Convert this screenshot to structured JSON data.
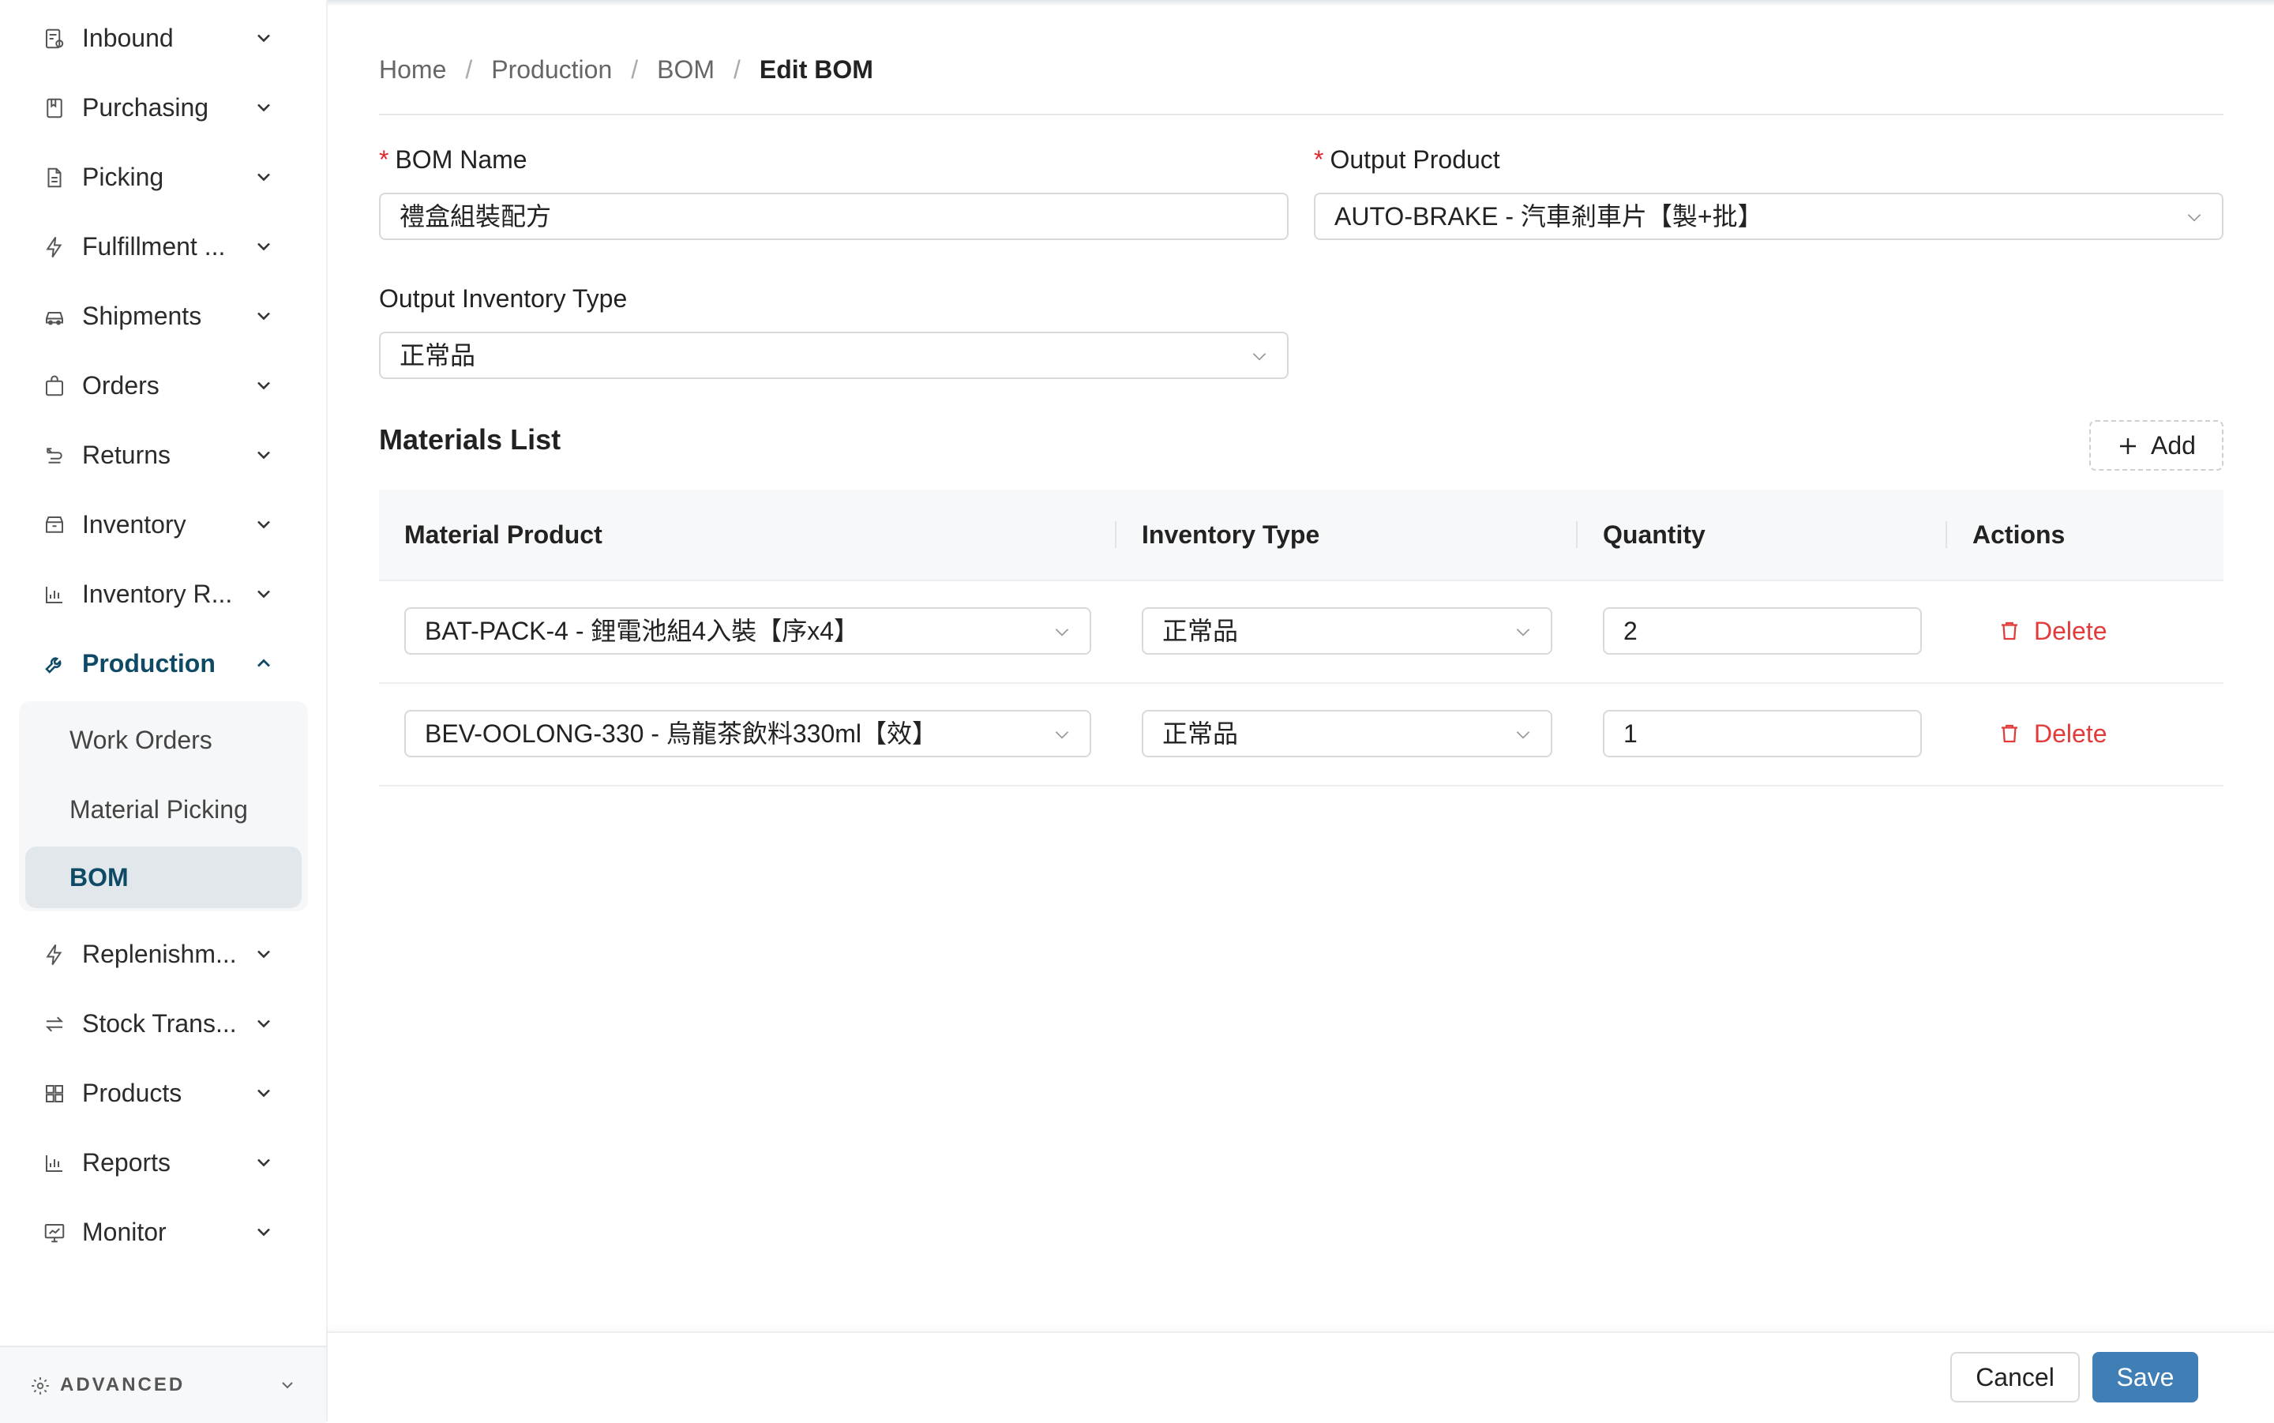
{
  "sidebar": {
    "items": [
      {
        "label": "Inbound",
        "icon": "inbound-icon"
      },
      {
        "label": "Purchasing",
        "icon": "purchasing-icon"
      },
      {
        "label": "Picking",
        "icon": "picking-icon"
      },
      {
        "label": "Fulfillment ...",
        "icon": "fulfillment-icon"
      },
      {
        "label": "Shipments",
        "icon": "shipments-icon"
      },
      {
        "label": "Orders",
        "icon": "orders-icon"
      },
      {
        "label": "Returns",
        "icon": "returns-icon"
      },
      {
        "label": "Inventory",
        "icon": "inventory-icon"
      },
      {
        "label": "Inventory R...",
        "icon": "inventory-report-icon"
      },
      {
        "label": "Production",
        "icon": "production-icon"
      },
      {
        "label": "Replenishm...",
        "icon": "replenishment-icon"
      },
      {
        "label": "Stock Trans...",
        "icon": "stock-transfer-icon"
      },
      {
        "label": "Products",
        "icon": "products-icon"
      },
      {
        "label": "Reports",
        "icon": "reports-icon"
      },
      {
        "label": "Monitor",
        "icon": "monitor-icon"
      }
    ],
    "active_item": "Production",
    "submenu": [
      {
        "label": "Work Orders"
      },
      {
        "label": "Material Picking"
      },
      {
        "label": "BOM"
      }
    ],
    "selected_submenu": "BOM",
    "advanced_label": "ADVANCED"
  },
  "breadcrumb": {
    "items": [
      "Home",
      "Production",
      "BOM"
    ],
    "current": "Edit BOM",
    "separator": "/"
  },
  "form": {
    "bom_name_label": "BOM Name",
    "bom_name_value": "禮盒組裝配方",
    "output_product_label": "Output Product",
    "output_product_value": "AUTO-BRAKE - 汽車剎車片【製+批】",
    "output_inventory_type_label": "Output Inventory Type",
    "output_inventory_type_value": "正常品",
    "required_mark": "*"
  },
  "materials": {
    "title": "Materials List",
    "add_label": "Add",
    "columns": [
      "Material Product",
      "Inventory Type",
      "Quantity",
      "Actions"
    ],
    "rows": [
      {
        "material": "BAT-PACK-4 - 鋰電池組4入裝【序x4】",
        "inventory_type": "正常品",
        "quantity": "2",
        "action": "Delete"
      },
      {
        "material": "BEV-OOLONG-330 - 烏龍茶飲料330ml【效】",
        "inventory_type": "正常品",
        "quantity": "1",
        "action": "Delete"
      }
    ]
  },
  "footer": {
    "cancel_label": "Cancel",
    "save_label": "Save"
  },
  "colors": {
    "accent": "#0e4a66",
    "primary_button": "#3f7fb6",
    "danger": "#e23b3b",
    "required": "#e0282e"
  }
}
